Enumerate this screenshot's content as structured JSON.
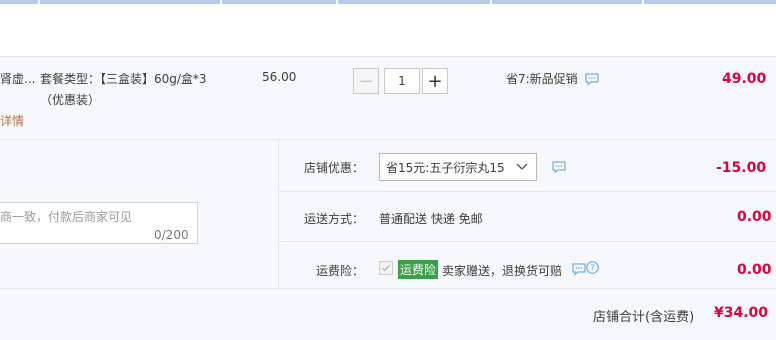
{
  "item": {
    "name_fragment": "肾虚...",
    "package_label": "套餐类型：【三盒装】60g/盒*3",
    "package_sub": "（优惠装）",
    "details_link": "详情",
    "unit_price": "56.00",
    "quantity": "1",
    "promo": "省7:新品促销",
    "subtotal": "49.00"
  },
  "note": {
    "placeholder_fragment": "商一致，付款后商家可见",
    "counter": "0/200"
  },
  "shop_discount": {
    "label": "店铺优惠：",
    "selected": "省15元:五子衍宗丸15",
    "amount": "-15.00"
  },
  "shipping": {
    "label": "运送方式：",
    "method": "普通配送 快递 免邮",
    "amount": "0.00"
  },
  "insurance": {
    "label": "运费险：",
    "badge": "运费险",
    "desc": "卖家赠送，退换货可赔",
    "amount": "0.00"
  },
  "summary": {
    "label": "店铺合计(含运费)",
    "total": "¥34.00"
  },
  "colors": {
    "accent_red": "#e4003a",
    "badge_green": "#3aa14a",
    "icon_blue": "#6fb0e6",
    "header_blue": "#b6ccec"
  },
  "icons": [
    "chat-icon",
    "question-icon",
    "chevron-down-icon",
    "checkbox-icon"
  ]
}
